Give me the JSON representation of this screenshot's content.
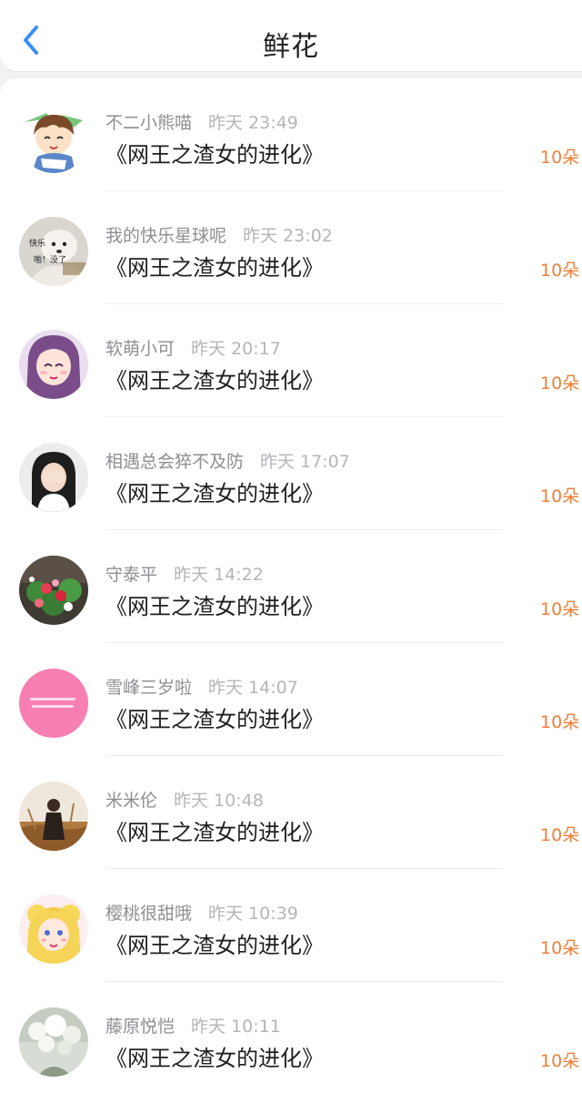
{
  "header": {
    "title": "鲜花"
  },
  "colors": {
    "accent": "#3a8ff5",
    "amount": "#ee7f3a"
  },
  "items": [
    {
      "name": "不二小熊喵",
      "time": "昨天 23:49",
      "book": "《网王之渣女的进化》",
      "amount": "10朵",
      "avatar_icon": "cartoon-boy-avatar"
    },
    {
      "name": "我的快乐星球呢",
      "time": "昨天 23:02",
      "book": "《网王之渣女的进化》",
      "amount": "10朵",
      "avatar_icon": "dog-meme-avatar",
      "avatar_text": [
        "快乐",
        "啪！没了"
      ]
    },
    {
      "name": "软萌小可",
      "time": "昨天 20:17",
      "book": "《网王之渣女的进化》",
      "amount": "10朵",
      "avatar_icon": "anime-girl-avatar"
    },
    {
      "name": "相遇总会猝不及防",
      "time": "昨天 17:07",
      "book": "《网王之渣女的进化》",
      "amount": "10朵",
      "avatar_icon": "girl-covering-face-avatar"
    },
    {
      "name": "守泰平",
      "time": "昨天 14:22",
      "book": "《网王之渣女的进化》",
      "amount": "10朵",
      "avatar_icon": "flower-bouquet-avatar"
    },
    {
      "name": "雪峰三岁啦",
      "time": "昨天 14:07",
      "book": "《网王之渣女的进化》",
      "amount": "10朵",
      "avatar_icon": "pink-text-avatar"
    },
    {
      "name": "米米伦",
      "time": "昨天 10:48",
      "book": "《网王之渣女的进化》",
      "amount": "10朵",
      "avatar_icon": "field-person-avatar"
    },
    {
      "name": "樱桃很甜哦",
      "time": "昨天 10:39",
      "book": "《网王之渣女的进化》",
      "amount": "10朵",
      "avatar_icon": "sailor-moon-avatar"
    },
    {
      "name": "藤原悦恺",
      "time": "昨天 10:11",
      "book": "《网王之渣女的进化》",
      "amount": "10朵",
      "avatar_icon": "white-flowers-avatar"
    }
  ]
}
